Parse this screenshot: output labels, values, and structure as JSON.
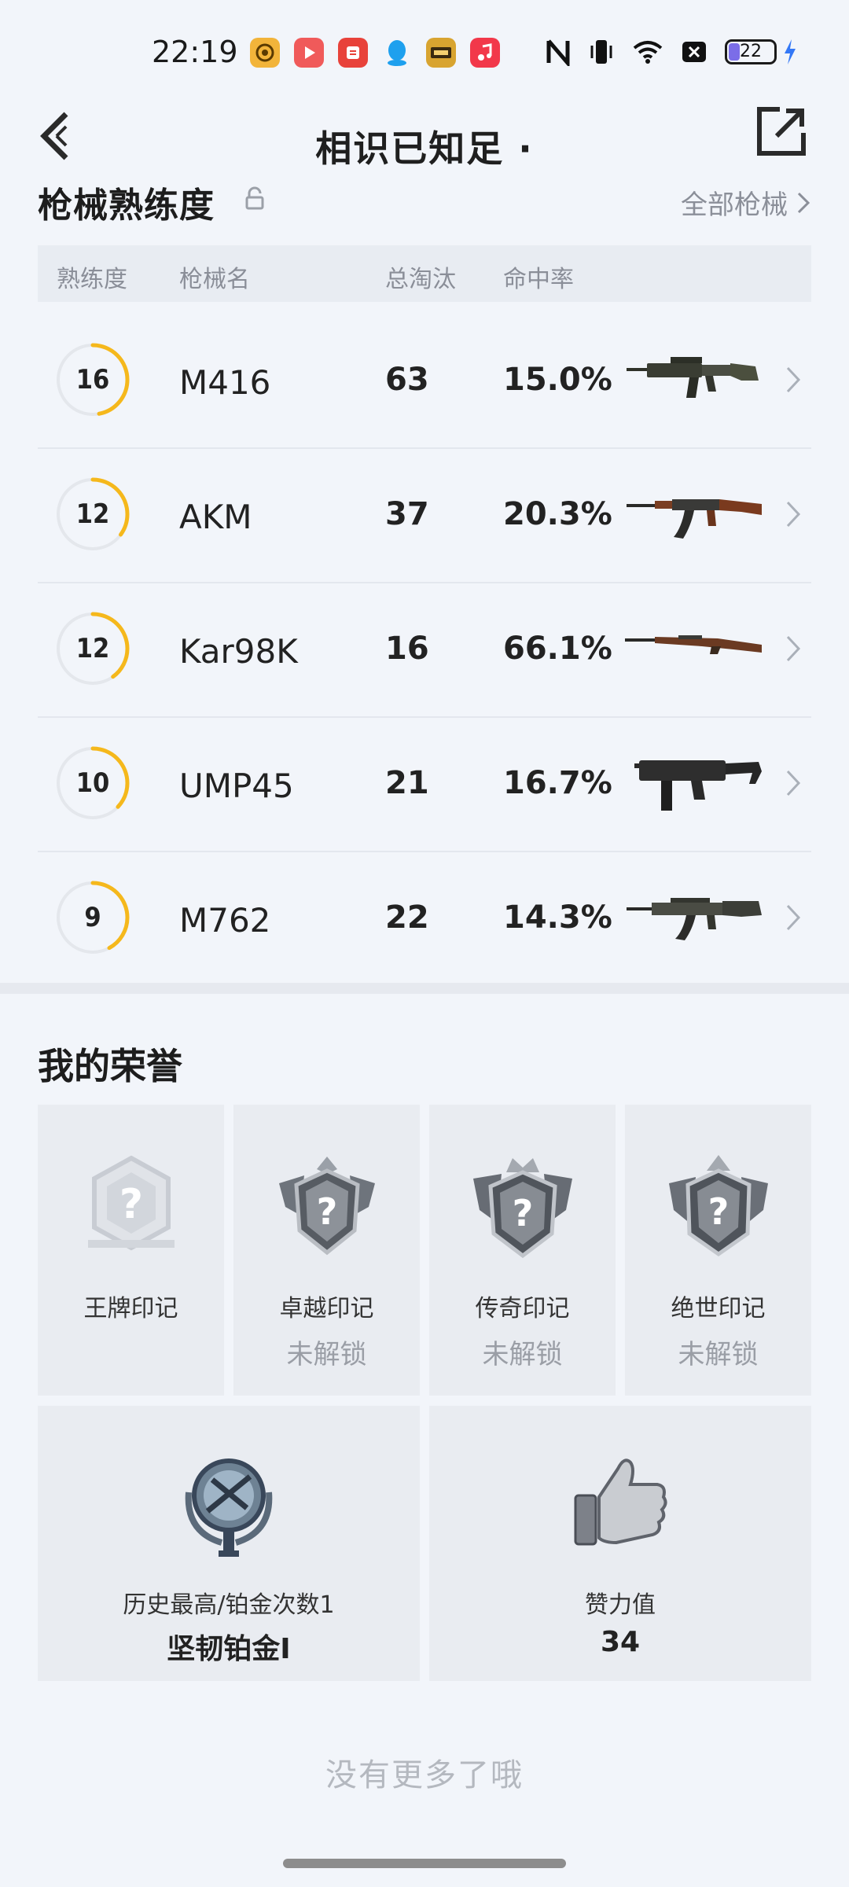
{
  "status_bar": {
    "time": "22:19",
    "app_icons": [
      {
        "name": "game-app-icon",
        "color": "#f2b43a"
      },
      {
        "name": "video-app-icon",
        "color": "#f05a5a"
      },
      {
        "name": "news-app-icon",
        "color": "#e8423a"
      },
      {
        "name": "qq-app-icon",
        "color": "#25a8f0"
      },
      {
        "name": "peace-elite-app-icon",
        "color": "#d8a430"
      },
      {
        "name": "music-app-icon",
        "color": "#f2384a"
      }
    ],
    "battery": "22"
  },
  "header": {
    "title": "相识已知足 ·"
  },
  "weapon_section": {
    "title": "枪械熟练度",
    "all_link": "全部枪械",
    "columns": {
      "proficiency": "熟练度",
      "name": "枪械名",
      "eliminations": "总淘汰",
      "accuracy": "命中率"
    },
    "weapons": [
      {
        "level": "16",
        "progress": 0.47,
        "name": "M416",
        "eliminations": "63",
        "accuracy": "15.0%",
        "type": "rifle-m416"
      },
      {
        "level": "12",
        "progress": 0.35,
        "name": "AKM",
        "eliminations": "37",
        "accuracy": "20.3%",
        "type": "rifle-akm"
      },
      {
        "level": "12",
        "progress": 0.4,
        "name": "Kar98K",
        "eliminations": "16",
        "accuracy": "66.1%",
        "type": "sniper-kar98k"
      },
      {
        "level": "10",
        "progress": 0.37,
        "name": "UMP45",
        "eliminations": "21",
        "accuracy": "16.7%",
        "type": "smg-ump45"
      },
      {
        "level": "9",
        "progress": 0.42,
        "name": "M762",
        "eliminations": "22",
        "accuracy": "14.3%",
        "type": "rifle-m762"
      }
    ],
    "ring_color": "#f5b81c"
  },
  "honors": {
    "title": "我的荣誉",
    "badges": [
      {
        "label": "王牌印记",
        "status": ""
      },
      {
        "label": "卓越印记",
        "status": "未解锁"
      },
      {
        "label": "传奇印记",
        "status": "未解锁"
      },
      {
        "label": "绝世印记",
        "status": "未解锁"
      }
    ],
    "stats": [
      {
        "label": "历史最高/铂金次数1",
        "value": "坚韧铂金I"
      },
      {
        "label": "赞力值",
        "value": "34"
      }
    ]
  },
  "footer": {
    "no_more": "没有更多了哦"
  }
}
